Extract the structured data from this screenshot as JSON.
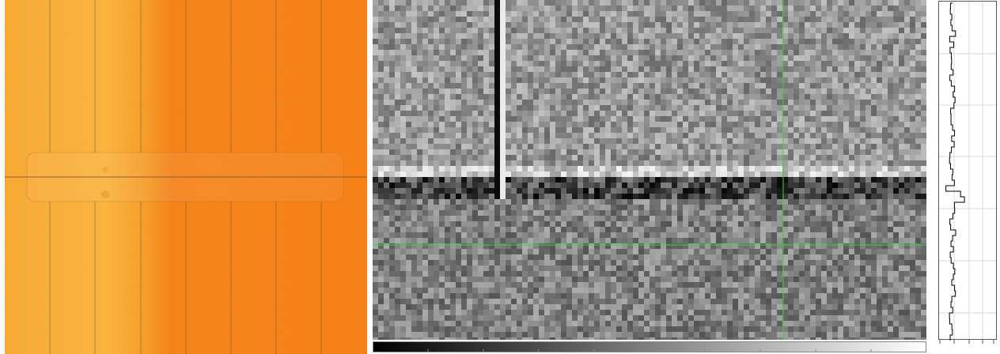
{
  "viewer": {
    "panels": [
      {
        "id": "detector-overview",
        "kind": "image",
        "colormap": "orange"
      },
      {
        "id": "zoomed-region",
        "kind": "image",
        "colormap": "grayscale"
      },
      {
        "id": "colorbar",
        "kind": "scale",
        "colormap": "grayscale"
      },
      {
        "id": "line-profile",
        "kind": "plot"
      }
    ],
    "colors": {
      "orange_light": "#f8ac2f",
      "orange_dark": "#f47a0c",
      "crosshair": "#39d139",
      "module_gap": "#6b4a2a",
      "plot_line": "#000000",
      "plot_grid": "#cccccc"
    },
    "crosshair": {
      "visible": true
    },
    "icons": []
  }
}
